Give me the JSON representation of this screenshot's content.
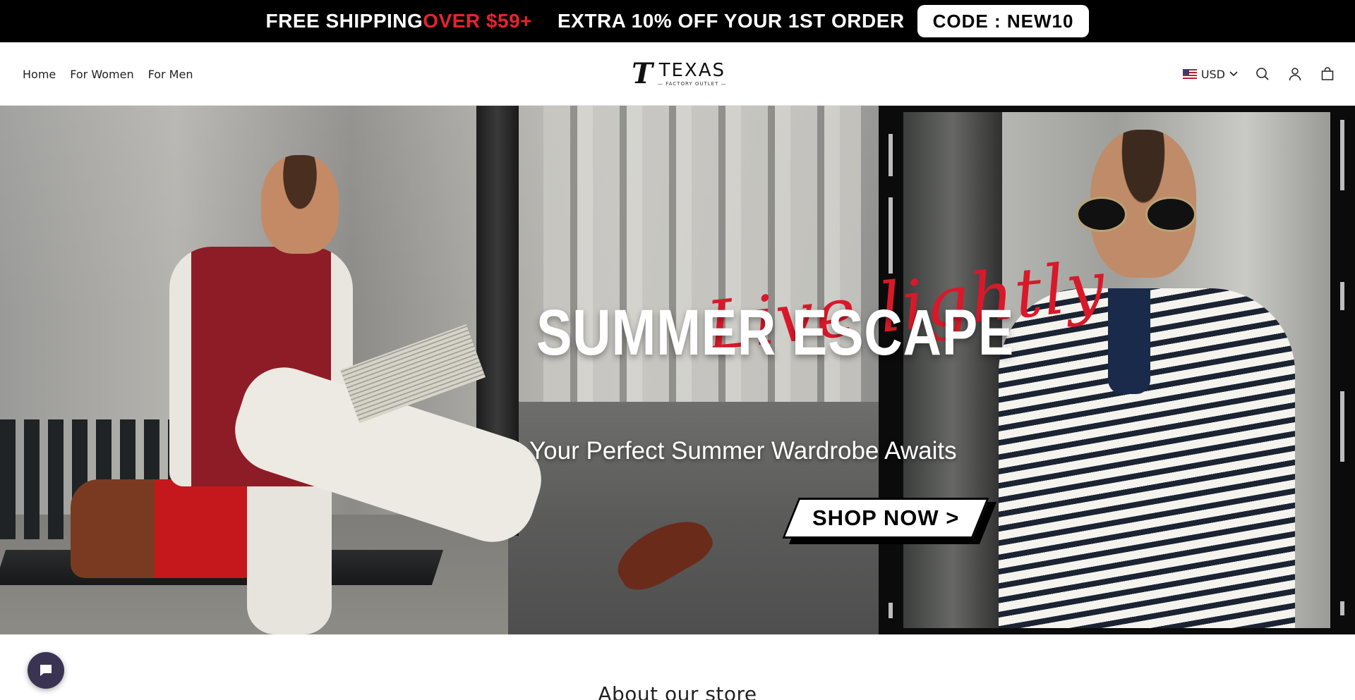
{
  "announcement": {
    "part1": "FREE SHIPPING ",
    "part1_highlight": "OVER $59+",
    "part2": "EXTRA 10% OFF YOUR 1ST ORDER",
    "code_label": "CODE :  NEW10",
    "colors": {
      "background": "#000000",
      "highlight": "#e8222e",
      "text": "#ffffff"
    }
  },
  "nav": {
    "items": [
      {
        "label": "Home"
      },
      {
        "label": "For Women"
      },
      {
        "label": "For Men"
      }
    ]
  },
  "logo": {
    "mark": "T",
    "name": "TEXAS",
    "tagline": "— FACTORY OUTLET —"
  },
  "header_utils": {
    "currency": "USD",
    "currency_flag": "us-flag-icon",
    "icons": [
      "search-icon",
      "account-icon",
      "cart-icon"
    ]
  },
  "hero": {
    "script_text": "Live lightly",
    "headline": "SUMMER ESCAPE",
    "subline": "Your Perfect Summer Wardrobe Awaits",
    "cta_label": "SHOP NOW >",
    "colors": {
      "script": "#d8192a",
      "headline": "#ffffff",
      "cta_bg": "#ffffff",
      "cta_text": "#000000"
    }
  },
  "chat_widget": {
    "icon": "chat-bubble-icon"
  },
  "section": {
    "title": "About our store"
  }
}
